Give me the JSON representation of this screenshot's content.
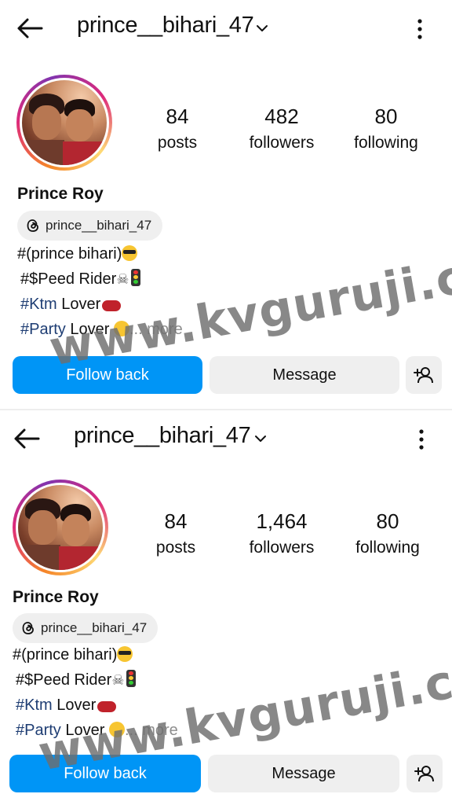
{
  "screenshots": [
    {
      "header": {
        "username": "prince__bihari_47"
      },
      "stats": [
        {
          "value": "84",
          "label": "posts"
        },
        {
          "value": "482",
          "label": "followers"
        },
        {
          "value": "80",
          "label": "following"
        }
      ],
      "profile": {
        "display_name": "Prince Roy",
        "threads_handle": "prince__bihari_47",
        "bio": {
          "line1": "#(prince bihari)",
          "line2": "#$Peed Rider",
          "line3_tag": "#Ktm",
          "line3_text": " Lover",
          "line4_tag": "#Party",
          "line4_text": " Lover ",
          "more": "... more"
        }
      },
      "actions": {
        "follow_back": "Follow back",
        "message": "Message"
      }
    },
    {
      "header": {
        "username": "prince__bihari_47"
      },
      "stats": [
        {
          "value": "84",
          "label": "posts"
        },
        {
          "value": "1,464",
          "label": "followers"
        },
        {
          "value": "80",
          "label": "following"
        }
      ],
      "profile": {
        "display_name": "Prince Roy",
        "threads_handle": "prince__bihari_47",
        "bio": {
          "line1": "#(prince bihari)",
          "line2": "#$Peed Rider",
          "line3_tag": "#Ktm",
          "line3_text": " Lover",
          "line4_tag": "#Party",
          "line4_text": " Lover ",
          "more": "... more"
        }
      },
      "actions": {
        "follow_back": "Follow back",
        "message": "Message"
      }
    }
  ],
  "watermark": "www.kvguruji.com",
  "colors": {
    "accent": "#0095f6",
    "secondary_button": "#efefef",
    "hashtag": "#1e3d73"
  },
  "icons": [
    "back-arrow-icon",
    "chevron-down-icon",
    "more-vertical-icon",
    "threads-icon",
    "add-person-icon",
    "sunglasses-emoji",
    "skull-emoji",
    "traffic-light-emoji",
    "motorcycle-emoji",
    "kiss-emoji"
  ]
}
